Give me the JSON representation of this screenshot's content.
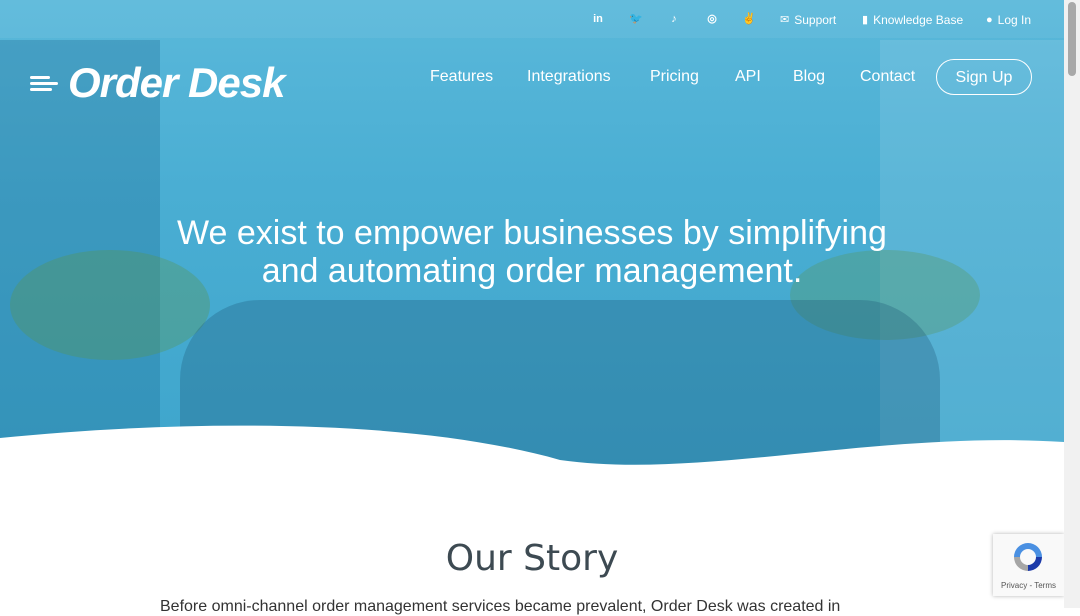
{
  "site": {
    "brand": "Order Desk"
  },
  "topbar": {
    "social": [
      {
        "icon": "linkedin-icon",
        "glyph": "in"
      },
      {
        "icon": "twitter-icon",
        "glyph": "🐦"
      },
      {
        "icon": "tiktok-icon",
        "glyph": "♪"
      },
      {
        "icon": "instagram-icon",
        "glyph": "◎"
      },
      {
        "icon": "award-icon",
        "glyph": "✌"
      }
    ],
    "support_label": "Support",
    "kb_label": "Knowledge Base",
    "login_label": "Log In"
  },
  "nav": {
    "features": "Features",
    "integrations": "Integrations",
    "pricing": "Pricing",
    "api": "API",
    "blog": "Blog",
    "contact": "Contact",
    "signup": "Sign Up"
  },
  "hero": {
    "headline_line1": "We exist to empower businesses by simplifying",
    "headline_line2": "and automating order management."
  },
  "story": {
    "heading": "Our Story",
    "paragraph_start": "Before omni-channel order management services became prevalent, Order Desk was created in"
  },
  "recaptcha": {
    "legal": "Privacy - Terms"
  },
  "colors": {
    "hero_blue": "#4aaed3",
    "heading_gray": "#3d4a52"
  }
}
